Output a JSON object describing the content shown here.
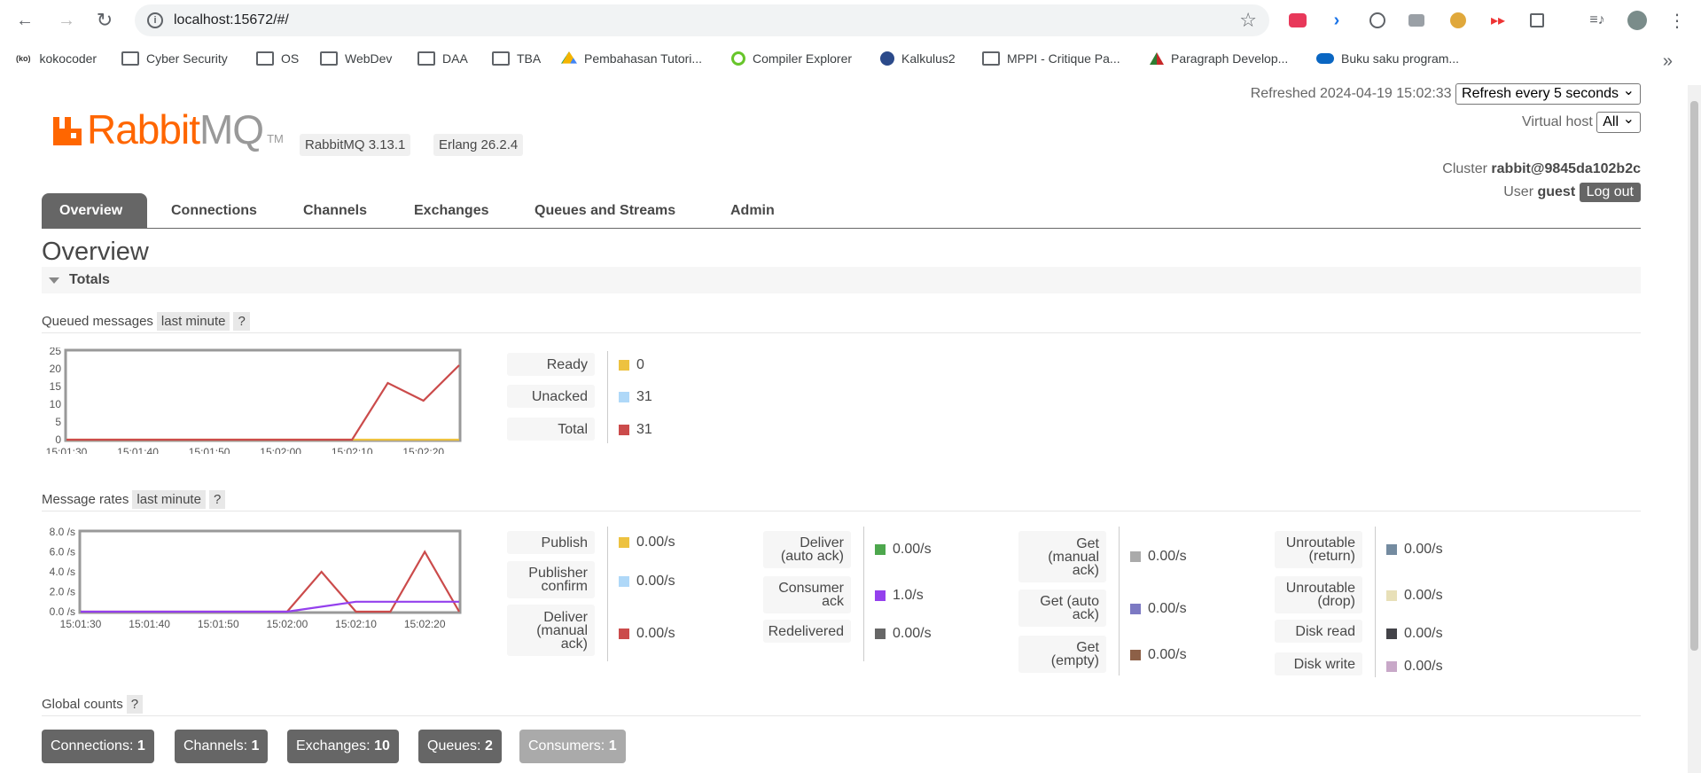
{
  "browser": {
    "url": "localhost:15672/#/",
    "bookmarks": [
      {
        "label": "kokocoder",
        "kind": "site"
      },
      {
        "label": "Cyber Security",
        "kind": "folder"
      },
      {
        "label": "OS",
        "kind": "folder"
      },
      {
        "label": "WebDev",
        "kind": "folder"
      },
      {
        "label": "DAA",
        "kind": "folder"
      },
      {
        "label": "TBA",
        "kind": "folder"
      },
      {
        "label": "Pembahasan Tutori...",
        "kind": "drive"
      },
      {
        "label": "Compiler Explorer",
        "kind": "site"
      },
      {
        "label": "Kalkulus2",
        "kind": "site"
      },
      {
        "label": "MPPI - Critique Pa...",
        "kind": "folder"
      },
      {
        "label": "Paragraph Develop...",
        "kind": "site"
      },
      {
        "label": "Buku saku program...",
        "kind": "onedrive"
      }
    ],
    "more_bookmarks": "»"
  },
  "header": {
    "logo_main": "Rabbit",
    "logo_mq": "MQ",
    "logo_tm": "TM",
    "version": "RabbitMQ 3.13.1",
    "erlang": "Erlang 26.2.4",
    "refreshed_label": "Refreshed",
    "refreshed_time": "2024-04-19 15:02:33",
    "refresh_select": "Refresh every 5 seconds",
    "vhost_label": "Virtual host",
    "vhost_select": "All",
    "cluster_label": "Cluster",
    "cluster_name": "rabbit@9845da102b2c",
    "user_label": "User",
    "user_name": "guest",
    "logout": "Log out"
  },
  "tabs": [
    "Overview",
    "Connections",
    "Channels",
    "Exchanges",
    "Queues and Streams",
    "Admin"
  ],
  "page_title": "Overview",
  "section_title": "Totals",
  "queued": {
    "title": "Queued messages",
    "range": "last minute",
    "help": "?",
    "legend": [
      {
        "label": "Ready",
        "value": "0",
        "color": "#edc240"
      },
      {
        "label": "Unacked",
        "value": "31",
        "color": "#afd8f8"
      },
      {
        "label": "Total",
        "value": "31",
        "color": "#cb4b4b"
      }
    ]
  },
  "rates": {
    "title": "Message rates",
    "range": "last minute",
    "help": "?",
    "col1": [
      {
        "label": "Publish",
        "value": "0.00/s",
        "color": "#edc240"
      },
      {
        "label": "Publisher confirm",
        "value": "0.00/s",
        "color": "#afd8f8"
      },
      {
        "label": "Deliver (manual ack)",
        "value": "0.00/s",
        "color": "#cb4b4b"
      }
    ],
    "col2": [
      {
        "label": "Deliver (auto ack)",
        "value": "0.00/s",
        "color": "#4da74d"
      },
      {
        "label": "Consumer ack",
        "value": "1.0/s",
        "color": "#9440ed"
      },
      {
        "label": "Redelivered",
        "value": "0.00/s",
        "color": "#666666"
      }
    ],
    "col3": [
      {
        "label": "Get (manual ack)",
        "value": "0.00/s",
        "color": "#aaaaaa"
      },
      {
        "label": "Get (auto ack)",
        "value": "0.00/s",
        "color": "#7c79c3"
      },
      {
        "label": "Get (empty)",
        "value": "0.00/s",
        "color": "#8d6047"
      }
    ],
    "col4": [
      {
        "label": "Unroutable (return)",
        "value": "0.00/s",
        "color": "#748ba0"
      },
      {
        "label": "Unroutable (drop)",
        "value": "0.00/s",
        "color": "#e8e0b8"
      },
      {
        "label": "Disk read",
        "value": "0.00/s",
        "color": "#434348"
      },
      {
        "label": "Disk write",
        "value": "0.00/s",
        "color": "#c8a8c8"
      }
    ]
  },
  "global": {
    "title": "Global counts",
    "help": "?",
    "counts": [
      {
        "label": "Connections:",
        "value": "1"
      },
      {
        "label": "Channels:",
        "value": "1"
      },
      {
        "label": "Exchanges:",
        "value": "10"
      },
      {
        "label": "Queues:",
        "value": "2"
      },
      {
        "label": "Consumers:",
        "value": "1"
      }
    ]
  },
  "chart_data": [
    {
      "type": "line",
      "x": [
        "15:01:30",
        "15:01:35",
        "15:01:40",
        "15:01:45",
        "15:01:50",
        "15:01:55",
        "15:02:00",
        "15:02:05",
        "15:02:10",
        "15:02:15",
        "15:02:20",
        "15:02:25"
      ],
      "xticks": [
        "15:01:30",
        "15:01:40",
        "15:01:50",
        "15:02:00",
        "15:02:10",
        "15:02:20"
      ],
      "yticks": [
        "25",
        "20",
        "15",
        "10",
        "5",
        "0"
      ],
      "ylim": [
        0,
        25
      ],
      "series": [
        {
          "name": "Ready",
          "color": "#edc240",
          "values": [
            0,
            0,
            0,
            0,
            0,
            0,
            0,
            0,
            0,
            0,
            0,
            0
          ]
        },
        {
          "name": "Total",
          "color": "#cb4b4b",
          "values": [
            0,
            0,
            0,
            0,
            0,
            0,
            0,
            0,
            0,
            16,
            11,
            21
          ]
        }
      ]
    },
    {
      "type": "line",
      "x": [
        "15:01:30",
        "15:01:35",
        "15:01:40",
        "15:01:45",
        "15:01:50",
        "15:01:55",
        "15:02:00",
        "15:02:05",
        "15:02:10",
        "15:02:15",
        "15:02:20",
        "15:02:25"
      ],
      "xticks": [
        "15:01:30",
        "15:01:40",
        "15:01:50",
        "15:02:00",
        "15:02:10",
        "15:02:20"
      ],
      "yticks": [
        "8.0 /s",
        "6.0 /s",
        "4.0 /s",
        "2.0 /s",
        "0.0 /s"
      ],
      "ylim": [
        0,
        8
      ],
      "series": [
        {
          "name": "Deliver (manual ack)",
          "color": "#cb4b4b",
          "values": [
            0,
            0,
            0,
            0,
            0,
            0,
            0,
            4,
            0,
            0,
            6,
            0
          ]
        },
        {
          "name": "Consumer ack",
          "color": "#9440ed",
          "values": [
            0,
            0,
            0,
            0,
            0,
            0,
            0,
            0.5,
            1,
            1,
            1,
            1
          ]
        }
      ]
    }
  ]
}
